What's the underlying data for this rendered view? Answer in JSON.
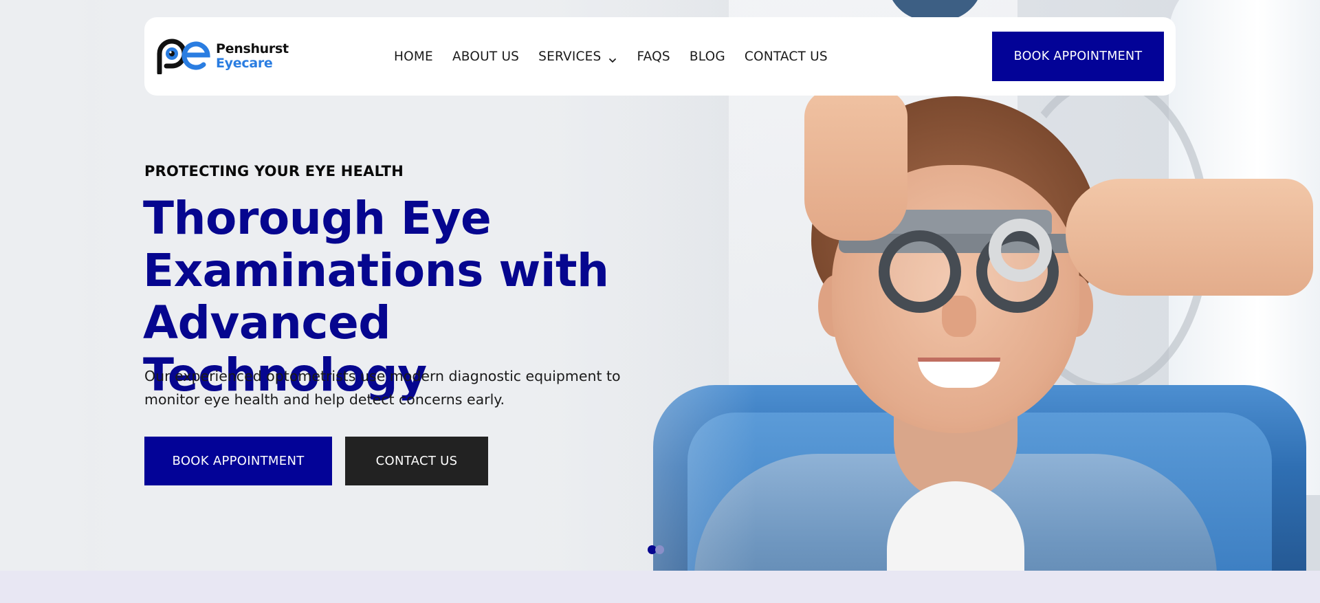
{
  "brand": {
    "name": "Penshurst",
    "sub": "Eyecare",
    "accent": "#030397",
    "logo_blue": "#2a7de1"
  },
  "nav": {
    "items": [
      "HOME",
      "ABOUT US",
      "SERVICES",
      "FAQS",
      "BLOG",
      "CONTACT US"
    ],
    "cta": "BOOK APPOINTMENT"
  },
  "hero": {
    "eyebrow": "PROTECTING YOUR EYE HEALTH",
    "headline_lines": [
      "Thorough Eye",
      "Examinations with",
      "Advanced Technology"
    ],
    "lead": "Our experienced optometrists use modern diagnostic equipment to monitor eye health and help detect concerns early.",
    "buttons": {
      "primary": "BOOK APPOINTMENT",
      "secondary": "CONTACT US"
    },
    "slides": {
      "count": 2,
      "active": 1
    }
  },
  "icons": {
    "services_dropdown": "chevron-down-icon",
    "logo": "eye-logo-icon"
  }
}
